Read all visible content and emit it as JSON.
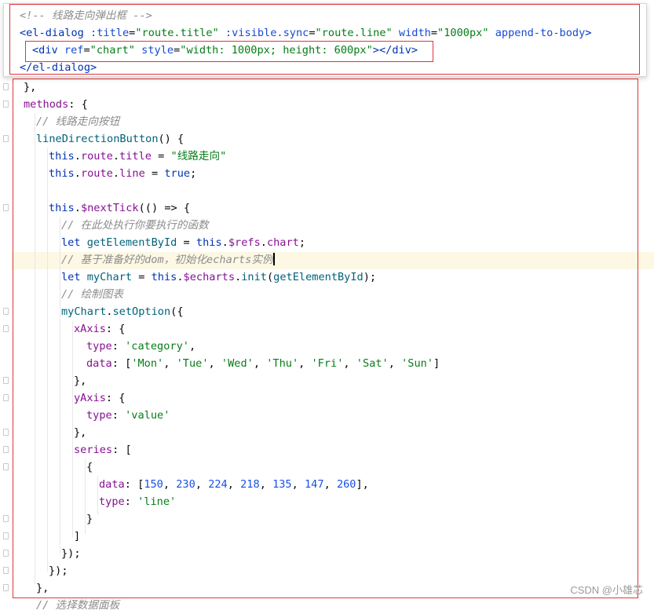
{
  "popup": {
    "lines": [
      {
        "parts": [
          [
            "cmt",
            "<!-- 线路走向弹出框 -->"
          ]
        ]
      },
      {
        "parts": [
          [
            "tag",
            "<el-dialog "
          ],
          [
            "attr",
            ":title"
          ],
          [
            "plain",
            "="
          ],
          [
            "attrval",
            "\"route.title\""
          ],
          [
            "plain",
            " "
          ],
          [
            "attr",
            ":visible.sync"
          ],
          [
            "plain",
            "="
          ],
          [
            "attrval",
            "\"route.line\""
          ],
          [
            "plain",
            " "
          ],
          [
            "attr",
            "width"
          ],
          [
            "plain",
            "="
          ],
          [
            "attrval",
            "\"1000px\""
          ],
          [
            "plain",
            " "
          ],
          [
            "attr",
            "append-to-body"
          ],
          [
            "tag",
            ">"
          ]
        ]
      },
      {
        "parts": [
          [
            "tag",
            "<div "
          ],
          [
            "attr",
            "ref"
          ],
          [
            "plain",
            "="
          ],
          [
            "attrval",
            "\"chart\""
          ],
          [
            "plain",
            " "
          ],
          [
            "attr",
            "style"
          ],
          [
            "plain",
            "="
          ],
          [
            "attrval",
            "\"width: 1000px; height: 600px\""
          ],
          [
            "tag",
            "></div>"
          ]
        ]
      },
      {
        "parts": [
          [
            "tag",
            "</el-dialog>"
          ]
        ]
      }
    ]
  },
  "code": {
    "lines": [
      {
        "indent": 0,
        "parts": [
          [
            "plain",
            "},"
          ]
        ]
      },
      {
        "indent": 0,
        "parts": [
          [
            "prop",
            "methods"
          ],
          [
            "plain",
            ": {"
          ]
        ]
      },
      {
        "indent": 1,
        "parts": [
          [
            "cmt",
            "// 线路走向按钮"
          ]
        ]
      },
      {
        "indent": 1,
        "parts": [
          [
            "fn",
            "lineDirectionButton"
          ],
          [
            "plain",
            "() {"
          ]
        ]
      },
      {
        "indent": 2,
        "parts": [
          [
            "kw",
            "this"
          ],
          [
            "plain",
            "."
          ],
          [
            "prop",
            "route"
          ],
          [
            "plain",
            "."
          ],
          [
            "prop",
            "title"
          ],
          [
            "plain",
            " = "
          ],
          [
            "str",
            "\"线路走向\""
          ]
        ]
      },
      {
        "indent": 2,
        "parts": [
          [
            "kw",
            "this"
          ],
          [
            "plain",
            "."
          ],
          [
            "prop",
            "route"
          ],
          [
            "plain",
            "."
          ],
          [
            "prop",
            "line"
          ],
          [
            "plain",
            " = "
          ],
          [
            "kw",
            "true"
          ],
          [
            "plain",
            ";"
          ]
        ]
      },
      {
        "indent": 2,
        "parts": []
      },
      {
        "indent": 2,
        "parts": [
          [
            "kw",
            "this"
          ],
          [
            "plain",
            "."
          ],
          [
            "prop",
            "$nextTick"
          ],
          [
            "plain",
            "(() => {"
          ]
        ]
      },
      {
        "indent": 3,
        "parts": [
          [
            "cmt",
            "// 在此处执行你要执行的函数"
          ]
        ]
      },
      {
        "indent": 3,
        "parts": [
          [
            "kw",
            "let "
          ],
          [
            "fn",
            "getElementById"
          ],
          [
            "plain",
            " = "
          ],
          [
            "kw",
            "this"
          ],
          [
            "plain",
            "."
          ],
          [
            "prop",
            "$refs"
          ],
          [
            "plain",
            "."
          ],
          [
            "prop",
            "chart"
          ],
          [
            "plain",
            ";"
          ]
        ]
      },
      {
        "indent": 3,
        "parts": [
          [
            "cmt",
            "// 基于准备好的dom，初始化echarts实例"
          ]
        ],
        "cursor": true
      },
      {
        "indent": 3,
        "parts": [
          [
            "kw",
            "let "
          ],
          [
            "fn",
            "myChart"
          ],
          [
            "plain",
            " = "
          ],
          [
            "kw",
            "this"
          ],
          [
            "plain",
            "."
          ],
          [
            "prop",
            "$echarts"
          ],
          [
            "plain",
            "."
          ],
          [
            "fn",
            "init"
          ],
          [
            "plain",
            "("
          ],
          [
            "fn",
            "getElementById"
          ],
          [
            "plain",
            ");"
          ]
        ]
      },
      {
        "indent": 3,
        "parts": [
          [
            "cmt",
            "// 绘制图表"
          ]
        ]
      },
      {
        "indent": 3,
        "parts": [
          [
            "fn",
            "myChart"
          ],
          [
            "plain",
            "."
          ],
          [
            "fn",
            "setOption"
          ],
          [
            "plain",
            "({"
          ]
        ]
      },
      {
        "indent": 4,
        "parts": [
          [
            "prop",
            "xAxis"
          ],
          [
            "plain",
            ": {"
          ]
        ]
      },
      {
        "indent": 5,
        "parts": [
          [
            "prop",
            "type"
          ],
          [
            "plain",
            ": "
          ],
          [
            "str",
            "'category'"
          ],
          [
            "plain",
            ","
          ]
        ]
      },
      {
        "indent": 5,
        "parts": [
          [
            "prop",
            "data"
          ],
          [
            "plain",
            ": ["
          ],
          [
            "str",
            "'Mon'"
          ],
          [
            "plain",
            ", "
          ],
          [
            "str",
            "'Tue'"
          ],
          [
            "plain",
            ", "
          ],
          [
            "str",
            "'Wed'"
          ],
          [
            "plain",
            ", "
          ],
          [
            "str",
            "'Thu'"
          ],
          [
            "plain",
            ", "
          ],
          [
            "str",
            "'Fri'"
          ],
          [
            "plain",
            ", "
          ],
          [
            "str",
            "'Sat'"
          ],
          [
            "plain",
            ", "
          ],
          [
            "str",
            "'Sun'"
          ],
          [
            "plain",
            "]"
          ]
        ]
      },
      {
        "indent": 4,
        "parts": [
          [
            "plain",
            "},"
          ]
        ]
      },
      {
        "indent": 4,
        "parts": [
          [
            "prop",
            "yAxis"
          ],
          [
            "plain",
            ": {"
          ]
        ]
      },
      {
        "indent": 5,
        "parts": [
          [
            "prop",
            "type"
          ],
          [
            "plain",
            ": "
          ],
          [
            "str",
            "'value'"
          ]
        ]
      },
      {
        "indent": 4,
        "parts": [
          [
            "plain",
            "},"
          ]
        ]
      },
      {
        "indent": 4,
        "parts": [
          [
            "prop",
            "series"
          ],
          [
            "plain",
            ": ["
          ]
        ]
      },
      {
        "indent": 5,
        "parts": [
          [
            "plain",
            "{"
          ]
        ]
      },
      {
        "indent": 6,
        "parts": [
          [
            "prop",
            "data"
          ],
          [
            "plain",
            ": ["
          ],
          [
            "num",
            "150"
          ],
          [
            "plain",
            ", "
          ],
          [
            "num",
            "230"
          ],
          [
            "plain",
            ", "
          ],
          [
            "num",
            "224"
          ],
          [
            "plain",
            ", "
          ],
          [
            "num",
            "218"
          ],
          [
            "plain",
            ", "
          ],
          [
            "num",
            "135"
          ],
          [
            "plain",
            ", "
          ],
          [
            "num",
            "147"
          ],
          [
            "plain",
            ", "
          ],
          [
            "num",
            "260"
          ],
          [
            "plain",
            "],"
          ]
        ]
      },
      {
        "indent": 6,
        "parts": [
          [
            "prop",
            "type"
          ],
          [
            "plain",
            ": "
          ],
          [
            "str",
            "'line'"
          ]
        ]
      },
      {
        "indent": 5,
        "parts": [
          [
            "plain",
            "}"
          ]
        ]
      },
      {
        "indent": 4,
        "parts": [
          [
            "plain",
            "]"
          ]
        ]
      },
      {
        "indent": 3,
        "parts": [
          [
            "plain",
            "});"
          ]
        ]
      },
      {
        "indent": 2,
        "parts": [
          [
            "plain",
            "});"
          ]
        ]
      },
      {
        "indent": 1,
        "parts": [
          [
            "plain",
            "},"
          ]
        ]
      },
      {
        "indent": 1,
        "parts": [
          [
            "cmt",
            "// 选择数据面板"
          ]
        ]
      }
    ]
  },
  "watermark": "CSDN @小雄芯"
}
